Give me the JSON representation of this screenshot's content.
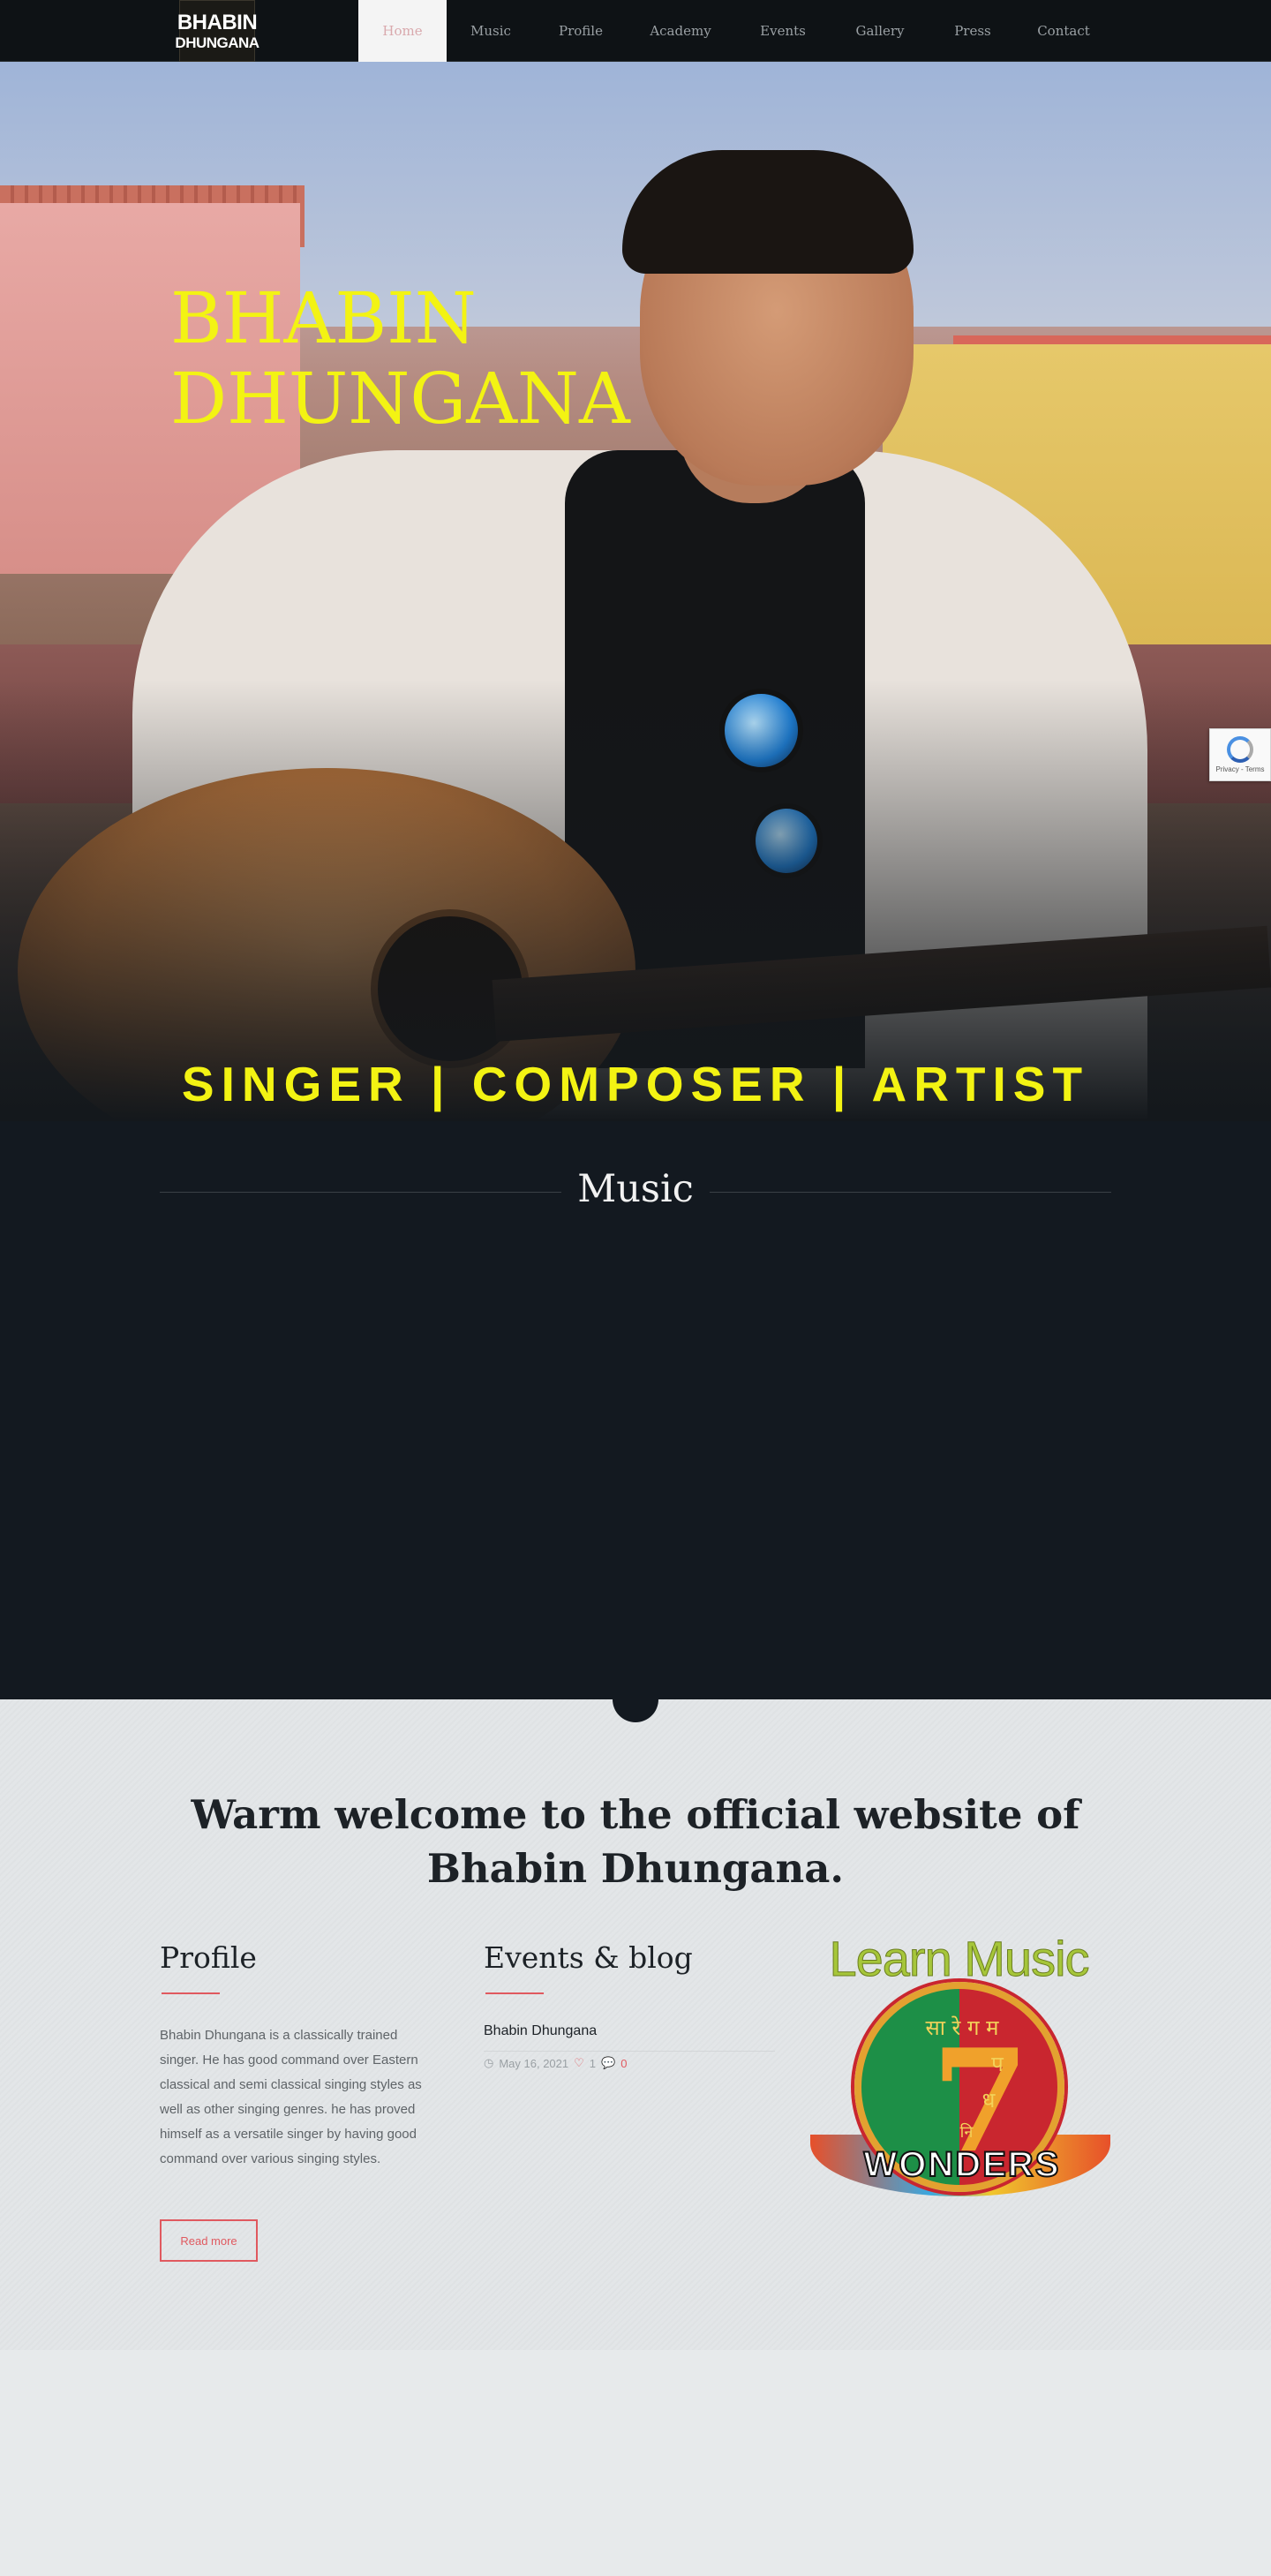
{
  "nav": {
    "logo_line1": "BHABIN",
    "logo_line2": "DHUNGANA",
    "items": [
      {
        "label": "Home",
        "active": true
      },
      {
        "label": "Music",
        "active": false
      },
      {
        "label": "Profile",
        "active": false
      },
      {
        "label": "Academy",
        "active": false
      },
      {
        "label": "Events",
        "active": false
      },
      {
        "label": "Gallery",
        "active": false
      },
      {
        "label": "Press",
        "active": false
      },
      {
        "label": "Contact",
        "active": false
      }
    ]
  },
  "hero": {
    "title_line1": "BHABIN",
    "title_line2": "DHUNGANA",
    "tagline": "SINGER | COMPOSER | ARTIST"
  },
  "recaptcha": {
    "text": "Privacy - Terms"
  },
  "music": {
    "title": "Music"
  },
  "welcome": {
    "title_line1": "Warm welcome to the official website of",
    "title_line2": "Bhabin Dhungana.",
    "profile": {
      "heading": "Profile",
      "text": "Bhabin Dhungana is a classically trained singer. He has good command over Eastern classical and semi classical singing styles as well as other singing genres. he has proved himself as a versatile singer by having good command over various singing styles.",
      "button": "Read more"
    },
    "events": {
      "heading": "Events & blog",
      "item_title": "Bhabin Dhungana",
      "date": "May 16, 2021",
      "likes": "1",
      "comments": "0"
    },
    "learn_music": {
      "title": "Learn Music",
      "swara_top": "सा रे ग म",
      "swara_mid": "प",
      "swara_mid2": "ध",
      "swara_bottom": "नि",
      "badge_numeral": "7",
      "ribbon_text": "WONDERS"
    }
  },
  "colors": {
    "accent": "#e0595f",
    "hero_text": "#f3f313",
    "nav_bg": "#0e1215",
    "music_bg": "#131920"
  }
}
